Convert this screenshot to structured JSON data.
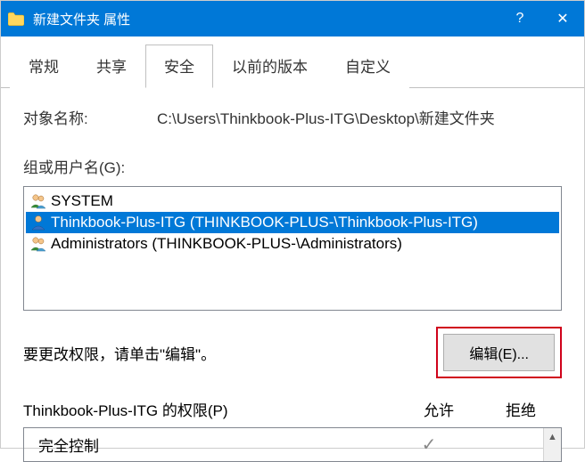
{
  "titlebar": {
    "title": "新建文件夹 属性",
    "help": "?",
    "close": "✕"
  },
  "tabs": [
    {
      "label": "常规",
      "active": false
    },
    {
      "label": "共享",
      "active": false
    },
    {
      "label": "安全",
      "active": true
    },
    {
      "label": "以前的版本",
      "active": false
    },
    {
      "label": "自定义",
      "active": false
    }
  ],
  "path": {
    "label": "对象名称:",
    "value": "C:\\Users\\Thinkbook-Plus-ITG\\Desktop\\新建文件夹"
  },
  "groupLabel": "组或用户名(G):",
  "users": [
    {
      "icon": "group",
      "text": "SYSTEM",
      "selected": false
    },
    {
      "icon": "user",
      "text": "Thinkbook-Plus-ITG (THINKBOOK-PLUS-\\Thinkbook-Plus-ITG)",
      "selected": true
    },
    {
      "icon": "group",
      "text": "Administrators (THINKBOOK-PLUS-\\Administrators)",
      "selected": false
    }
  ],
  "editHint": "要更改权限，请单击\"编辑\"。",
  "editButton": "编辑(E)...",
  "perm": {
    "title": "Thinkbook-Plus-ITG 的权限(P)",
    "allow": "允许",
    "deny": "拒绝",
    "rows": [
      {
        "name": "完全控制",
        "allow": "✓",
        "deny": ""
      }
    ]
  }
}
